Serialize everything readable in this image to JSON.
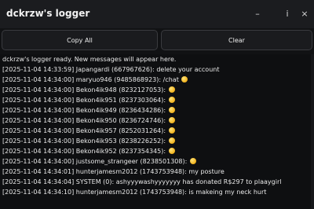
{
  "window": {
    "title": "dckrzw's logger",
    "minimize_glyph": "–",
    "info_glyph": "i",
    "close_glyph": "×"
  },
  "toolbar": {
    "copy_label": "Copy All",
    "clear_label": "Clear"
  },
  "log": {
    "intro": "dckrzw's logger ready. New messages will appear here.",
    "lines": [
      {
        "text": "[2025-11-04 14:33:59] Japangardi (667967626): delete your account",
        "emoji": false
      },
      {
        "text": "[2025-11-04 14:34:00] maryuo946 (9485868923): /chat",
        "emoji": true
      },
      {
        "text": "[2025-11-04 14:34:00] Bekon4ik948 (8232127053):",
        "emoji": true
      },
      {
        "text": "[2025-11-04 14:34:00] Bekon4ik951 (8237303064):",
        "emoji": true
      },
      {
        "text": "[2025-11-04 14:34:00] Bekon4ik949 (8236434286):",
        "emoji": true
      },
      {
        "text": "[2025-11-04 14:34:00] Bekon4ik950 (8236724746):",
        "emoji": true
      },
      {
        "text": "[2025-11-04 14:34:00] Bekon4ik957 (8252031264):",
        "emoji": true
      },
      {
        "text": "[2025-11-04 14:34:00] Bekon4ik953 (8238226252):",
        "emoji": true
      },
      {
        "text": "[2025-11-04 14:34:00] Bekon4ik952 (8237354345):",
        "emoji": true
      },
      {
        "text": "[2025-11-04 14:34:00] justsome_strangeer (8238501308):",
        "emoji": true
      },
      {
        "text": "[2025-11-04 14:34:01] hunterjamesm2012 (1743753948): my posture",
        "emoji": false
      },
      {
        "text": "[2025-11-04 14:34:04] SYSTEM (0): ashyyywashyyyyyyy has donated R$297 to plaaygirl",
        "emoji": false
      },
      {
        "text": "[2025-11-04 14:34:10] hunterjamesm2012 (1743753948): is makeing my neck hurt",
        "emoji": false
      }
    ]
  }
}
